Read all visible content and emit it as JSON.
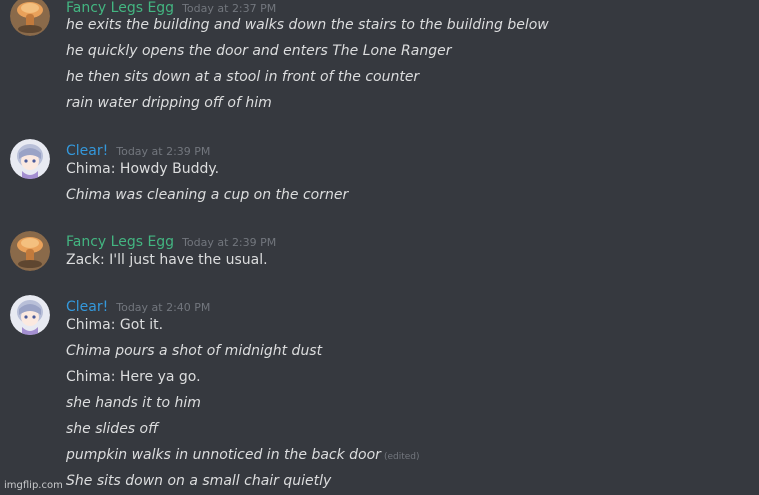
{
  "colors": {
    "fancy_username": "#43b581",
    "clear_username": "#3498db",
    "message_text": "#dcddde",
    "timestamp": "#72767d",
    "background": "#36393f"
  },
  "messages": [
    {
      "author": "Fancy Legs Egg",
      "timestamp": "Today at 2:37 PM",
      "avatar": "pumpkin-avatar",
      "lines": [
        {
          "text": "he exits the building and walks down the stairs to the building below",
          "italic": true
        },
        {
          "text": "he quickly opens the door and enters The Lone Ranger",
          "italic": true
        },
        {
          "text": "he then sits down at a stool in front of the counter",
          "italic": true
        },
        {
          "text": "rain water dripping off of him",
          "italic": true
        }
      ]
    },
    {
      "author": "Clear!",
      "timestamp": "Today at 2:39 PM",
      "avatar": "anime-girl-avatar",
      "lines": [
        {
          "text": "Chima: Howdy Buddy.",
          "italic": false
        },
        {
          "text": "Chima was cleaning a cup on the corner",
          "italic": true
        }
      ]
    },
    {
      "author": "Fancy Legs Egg",
      "timestamp": "Today at 2:39 PM",
      "avatar": "pumpkin-avatar",
      "lines": [
        {
          "text": "Zack: I'll just have the usual.",
          "italic": false
        }
      ]
    },
    {
      "author": "Clear!",
      "timestamp": "Today at 2:40 PM",
      "avatar": "anime-girl-avatar",
      "lines": [
        {
          "text": "Chima: Got it.",
          "italic": false
        },
        {
          "text": "Chima pours a shot of midnight dust",
          "italic": true
        },
        {
          "text": "Chima: Here ya go.",
          "italic": false
        },
        {
          "text": "she hands it to him",
          "italic": true
        },
        {
          "text": "she slides off",
          "italic": true
        },
        {
          "text": "pumpkin walks in unnoticed in the back door",
          "italic": true,
          "edited": "(edited)"
        },
        {
          "text": "She sits down on a small chair quietly",
          "italic": true
        }
      ]
    }
  ],
  "watermark": "imgflip.com"
}
